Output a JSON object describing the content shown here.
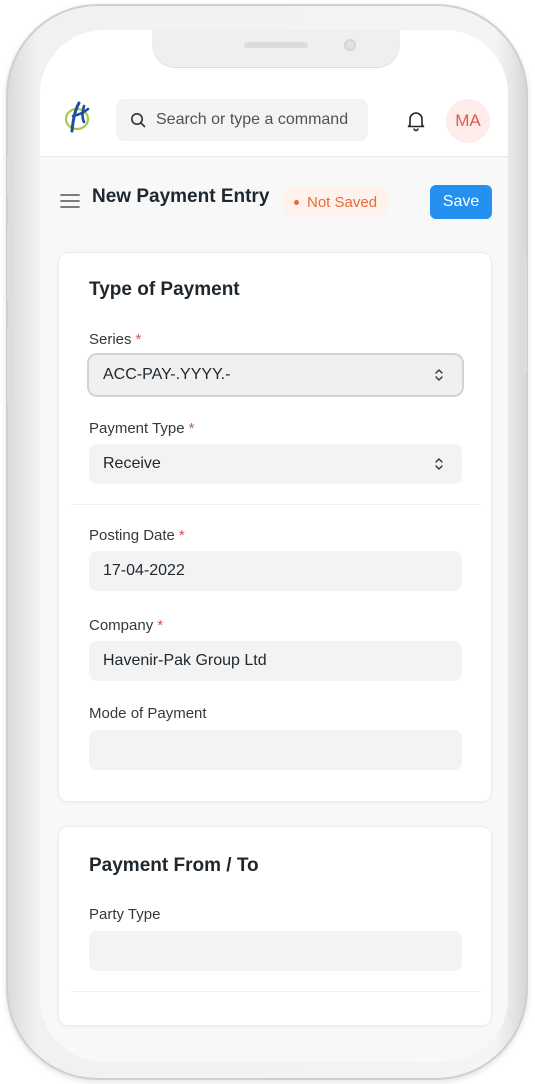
{
  "navbar": {
    "search_placeholder": "Search or type a command",
    "avatar_initials": "MA"
  },
  "page": {
    "title": "New Payment Entry",
    "status": "Not Saved",
    "save_label": "Save"
  },
  "sections": [
    {
      "title": "Type of Payment",
      "fields": [
        {
          "label": "Series",
          "required": "*",
          "value": "ACC-PAY-.YYYY.-",
          "kind": "select"
        },
        {
          "label": "Payment Type",
          "required": "*",
          "value": "Receive",
          "kind": "select"
        },
        {
          "label": "Posting Date",
          "required": "*",
          "value": "17-04-2022",
          "kind": "date"
        },
        {
          "label": "Company",
          "required": "*",
          "value": "Havenir-Pak Group Ltd",
          "kind": "link"
        },
        {
          "label": "Mode of Payment",
          "value": "",
          "kind": "link"
        }
      ]
    },
    {
      "title": "Payment From / To",
      "fields": [
        {
          "label": "Party Type",
          "value": "",
          "kind": "link"
        }
      ]
    }
  ],
  "colors": {
    "primary": "#2490ef",
    "status_text": "#e86c3a",
    "status_bg": "#fff1ec",
    "required": "#e24c4c",
    "avatar_text": "#e05a4a",
    "avatar_bg": "#fdecea"
  }
}
